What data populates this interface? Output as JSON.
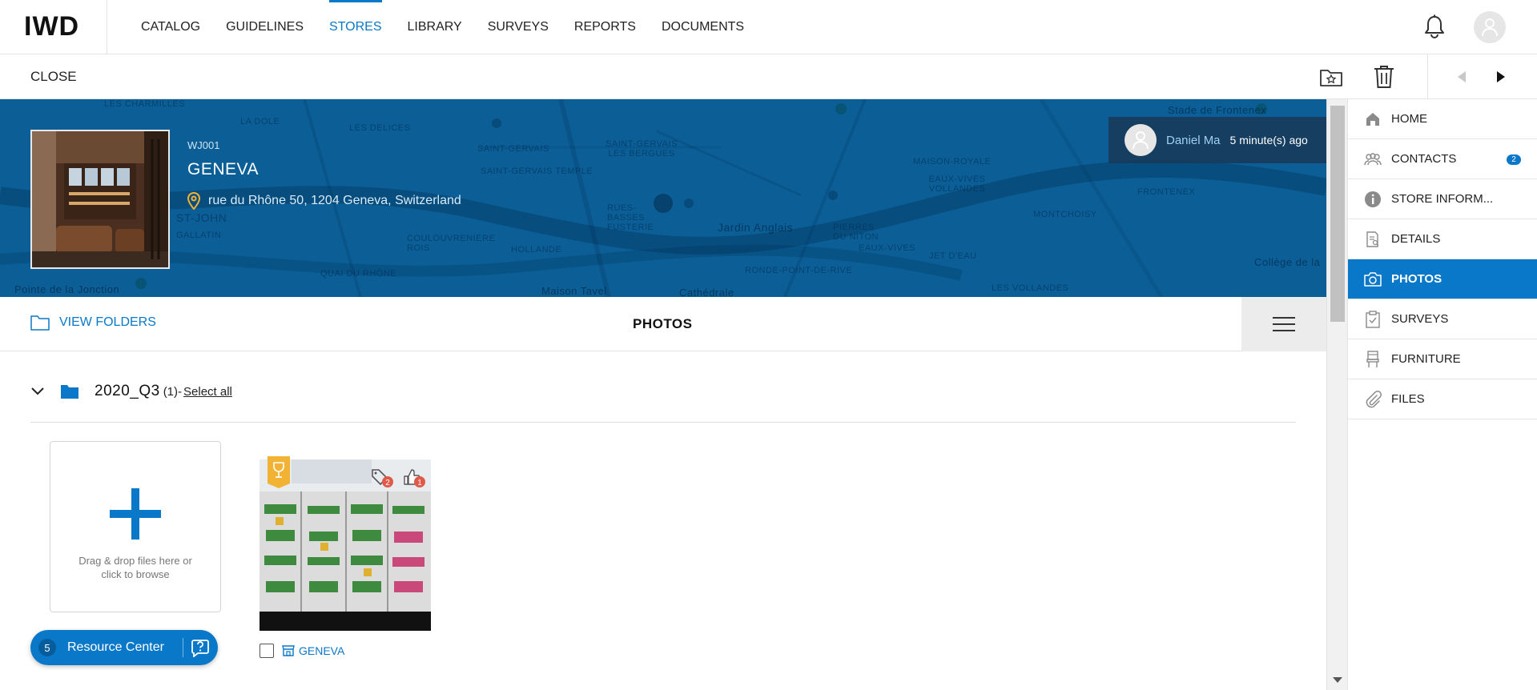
{
  "app": {
    "logo_text": "IWD"
  },
  "nav": {
    "items": [
      {
        "label": "CATALOG",
        "active": false
      },
      {
        "label": "GUIDELINES",
        "active": false
      },
      {
        "label": "STORES",
        "active": true
      },
      {
        "label": "LIBRARY",
        "active": false
      },
      {
        "label": "SURVEYS",
        "active": false
      },
      {
        "label": "REPORTS",
        "active": false
      },
      {
        "label": "DOCUMENTS",
        "active": false
      }
    ]
  },
  "toolbar": {
    "close_label": "CLOSE",
    "icons": [
      "folder-star-icon",
      "trash-icon",
      "prev-arrow-icon",
      "next-arrow-icon"
    ]
  },
  "store": {
    "code": "WJ001",
    "name": "GENEVA",
    "address": "rue du Rhône 50, 1204 Geneva, Switzerland"
  },
  "map_labels": [
    "LES CHARMILLES",
    "LA DOLE",
    "LES DELICES",
    "SAINT-GERVAIS",
    "SAINT-GERVAIS LES BERGUES",
    "SAINT-GERVAIS TEMPLE",
    "RUES-BASSES FUSTERIE",
    "ST-JOHN",
    "GALLATIN",
    "COULOUVRENIERE ROIS",
    "HOLLANDE",
    "QUAI DU RHÔNE",
    "Pointe de la Jonction",
    "Jardin Anglais",
    "PIERRES DU NITON",
    "EAUX-VIVES",
    "JET D'EAU",
    "MAISON-ROYALE",
    "EAUX-VIVES VOLLANDES",
    "MONTCHOISY",
    "FRONTENEX",
    "RONDE-POINT-DE-RIVE",
    "LES VOLLANDES",
    "Stade de Frontenex",
    "Collège de la",
    "Maison Tavel",
    "Cathédrale"
  ],
  "activity": {
    "user": "Daniel Ma",
    "time": "5 minute(s) ago"
  },
  "content": {
    "view_folders_label": "VIEW FOLDERS",
    "title": "PHOTOS"
  },
  "folder": {
    "name": "2020_Q3",
    "count": "(1)-",
    "select_all_label": "Select all"
  },
  "upload": {
    "text": "Drag & drop files here or click to browse"
  },
  "photo": {
    "tag_count": "2",
    "like_count": "1",
    "store_label": "GENEVA"
  },
  "resource_center": {
    "count": "5",
    "label": "Resource Center"
  },
  "sidebar": {
    "items": [
      {
        "label": "HOME",
        "icon": "home-icon",
        "active": false
      },
      {
        "label": "CONTACTS",
        "icon": "contacts-icon",
        "active": false,
        "badge": "2"
      },
      {
        "label": "STORE INFORM...",
        "icon": "info-icon",
        "active": false
      },
      {
        "label": "DETAILS",
        "icon": "details-icon",
        "active": false
      },
      {
        "label": "PHOTOS",
        "icon": "camera-icon",
        "active": true
      },
      {
        "label": "SURVEYS",
        "icon": "clipboard-icon",
        "active": false
      },
      {
        "label": "FURNITURE",
        "icon": "chair-icon",
        "active": false
      },
      {
        "label": "FILES",
        "icon": "paperclip-icon",
        "active": false
      }
    ]
  },
  "colors": {
    "accent": "#0a78c8",
    "hero_bg": "#0b5f96",
    "notification_red": "#e05a4a",
    "ribbon_gold": "#f2b233"
  }
}
